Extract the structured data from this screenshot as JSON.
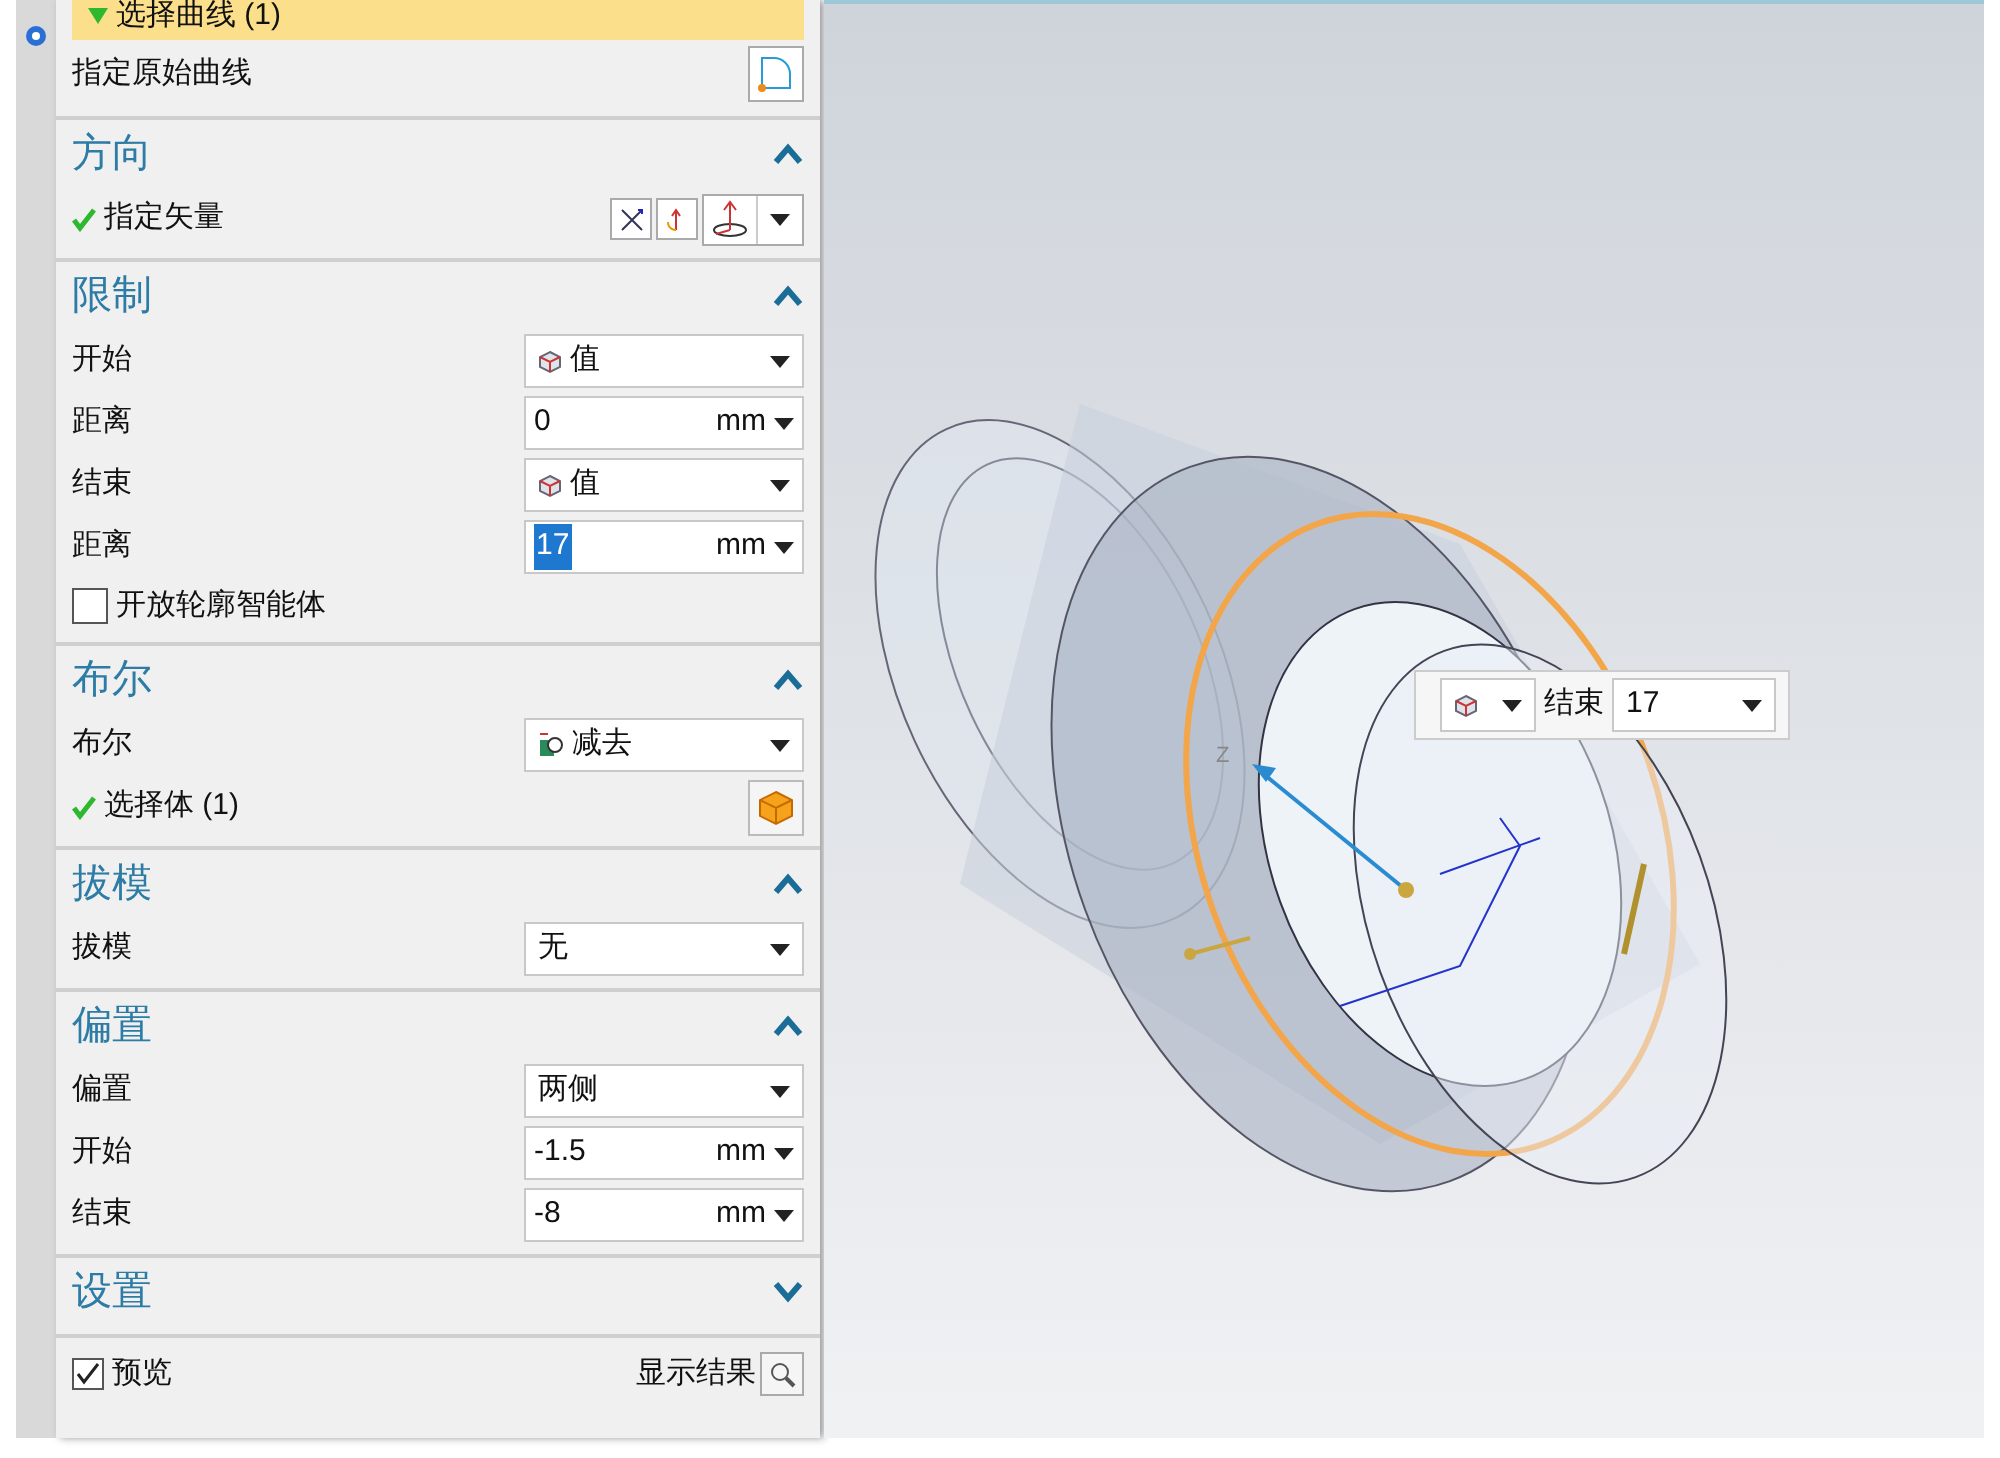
{
  "selection": {
    "label": "选择曲线 (1)",
    "checked": true,
    "highlighted": true
  },
  "original_curve": {
    "label": "指定原始曲线"
  },
  "sections": [
    {
      "title": "方向",
      "expanded": true,
      "rows": [
        {
          "kind": "vector",
          "label": "指定矢量",
          "checked": true
        }
      ]
    },
    {
      "title": "限制",
      "expanded": true,
      "rows": [
        {
          "kind": "value_dropdown",
          "label": "开始",
          "value": "值"
        },
        {
          "kind": "unit",
          "label": "距离",
          "value": "0",
          "unit": "mm",
          "highlighted": false
        },
        {
          "kind": "value_dropdown",
          "label": "结束",
          "value": "值"
        },
        {
          "kind": "unit",
          "label": "距离",
          "value": "17",
          "unit": "mm",
          "highlighted": true
        },
        {
          "kind": "checkbox",
          "label": "开放轮廓智能体",
          "checked": false
        }
      ]
    },
    {
      "title": "布尔",
      "expanded": true,
      "rows": [
        {
          "kind": "boolean_dropdown",
          "label": "布尔",
          "value": "减去"
        },
        {
          "kind": "select",
          "label": "选择体 (1)",
          "checked": true
        }
      ]
    },
    {
      "title": "拔模",
      "expanded": true,
      "rows": [
        {
          "kind": "dropdown",
          "label": "拔模",
          "value": "无"
        }
      ]
    },
    {
      "title": "偏置",
      "expanded": true,
      "rows": [
        {
          "kind": "dropdown",
          "label": "偏置",
          "value": "两侧"
        },
        {
          "kind": "unit",
          "label": "开始",
          "value": "-1.5",
          "unit": "mm",
          "highlighted": false
        },
        {
          "kind": "unit",
          "label": "结束",
          "value": "-8",
          "unit": "mm",
          "highlighted": false
        }
      ]
    },
    {
      "title": "设置",
      "expanded": false
    }
  ],
  "footer": {
    "preview": {
      "label": "预览",
      "checked": true
    },
    "show_result": "显示结果"
  },
  "viewport": {
    "axis_label": "Z",
    "popup": {
      "label": "结束",
      "value": "17"
    }
  }
}
